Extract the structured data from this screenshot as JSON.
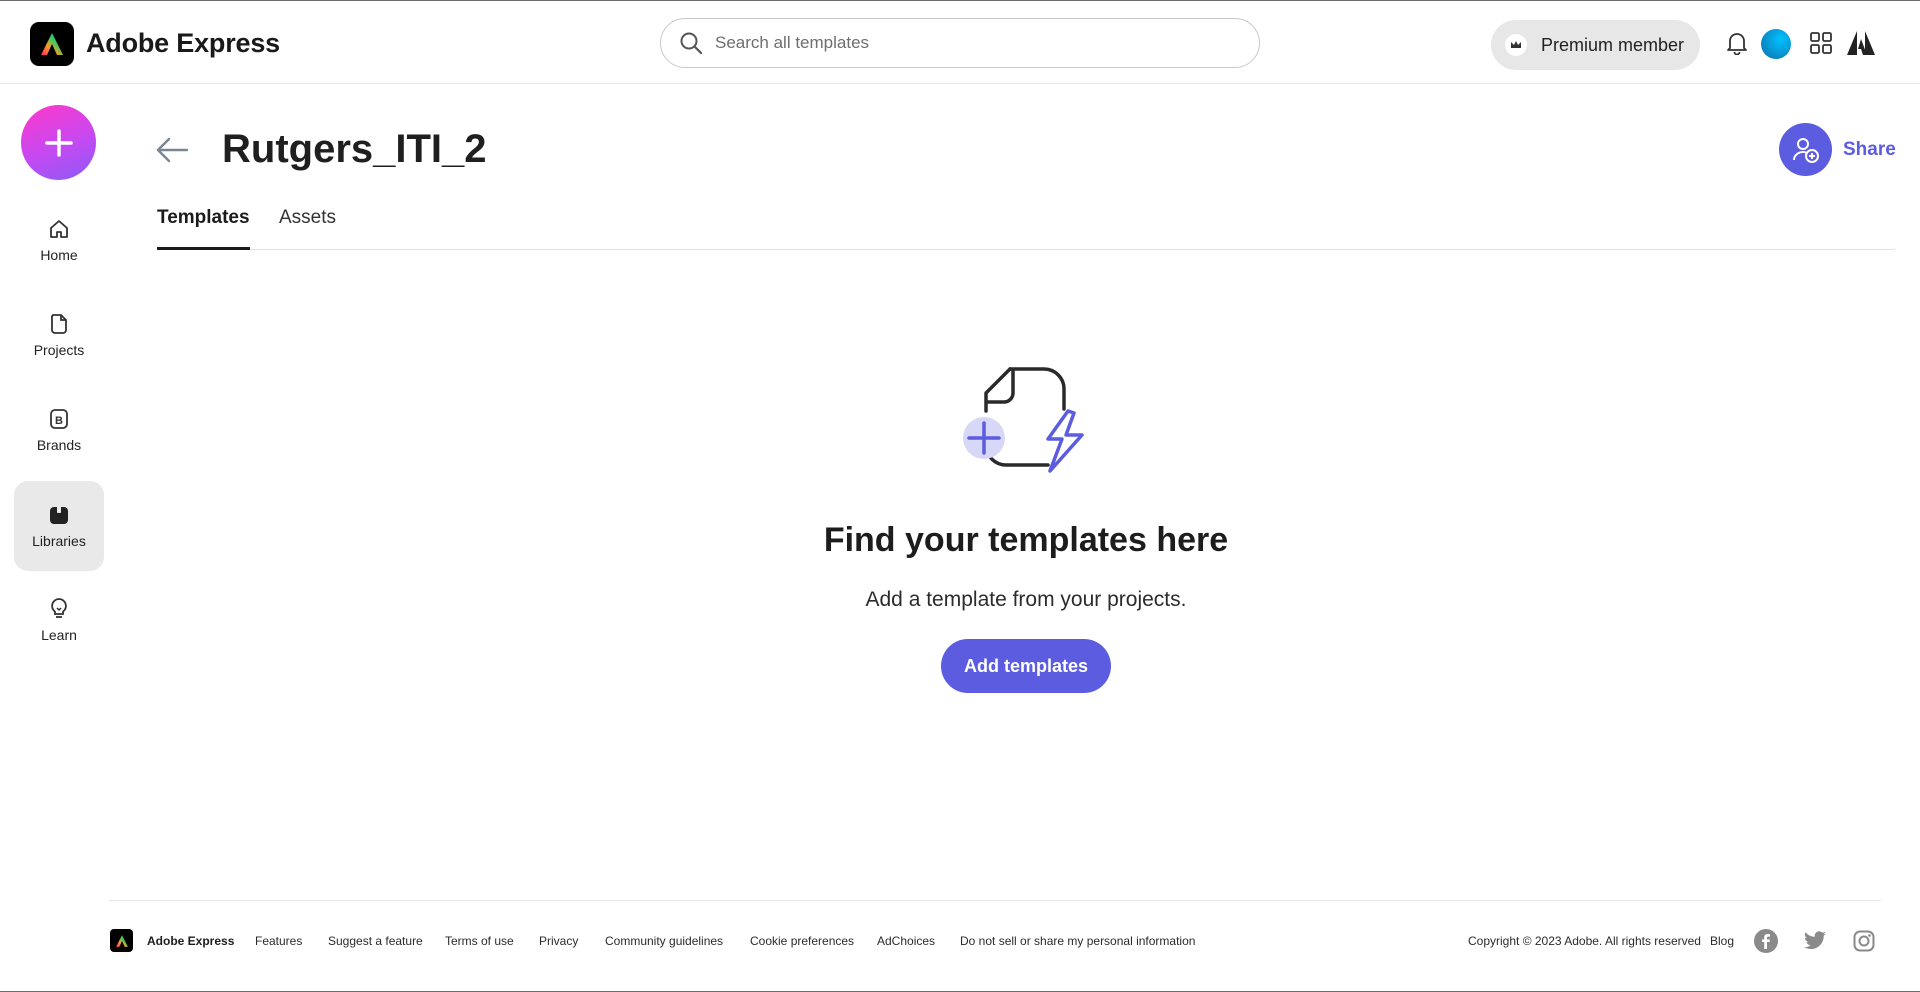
{
  "header": {
    "app_name": "Adobe Express",
    "search_placeholder": "Search all templates",
    "premium_label": "Premium member",
    "accent_color": "#5c5ce0"
  },
  "sidebar": {
    "create_icon": "plus-icon",
    "items": [
      {
        "label": "Home",
        "icon": "home-icon"
      },
      {
        "label": "Projects",
        "icon": "projects-icon"
      },
      {
        "label": "Brands",
        "icon": "brands-icon"
      },
      {
        "label": "Libraries",
        "icon": "libraries-icon",
        "active": true
      },
      {
        "label": "Learn",
        "icon": "lightbulb-icon"
      }
    ]
  },
  "main": {
    "title": "Rutgers_ITI_2",
    "share_label": "Share",
    "tabs": [
      {
        "label": "Templates",
        "active": true
      },
      {
        "label": "Assets",
        "active": false
      }
    ],
    "empty_state": {
      "title": "Find your templates here",
      "subtitle": "Add a template from your projects.",
      "button_label": "Add templates"
    }
  },
  "footer": {
    "brand": "Adobe Express",
    "links": [
      "Features",
      "Suggest a feature",
      "Terms of use",
      "Privacy",
      "Community guidelines",
      "Cookie preferences",
      "AdChoices",
      "Do not sell or share my personal information"
    ],
    "copyright": "Copyright © 2023 Adobe. All rights reserved",
    "blog": "Blog",
    "social": [
      "facebook-icon",
      "twitter-icon",
      "instagram-icon"
    ]
  }
}
